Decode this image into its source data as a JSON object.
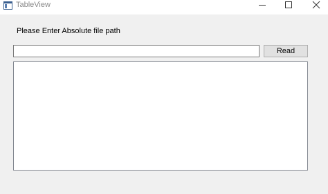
{
  "window": {
    "title": "TableView",
    "controls": {
      "minimize_icon": "minimize-icon",
      "maximize_icon": "maximize-icon",
      "close_icon": "close-icon"
    }
  },
  "form": {
    "prompt_label": "Please Enter Absolute file path",
    "path_value": "",
    "path_placeholder": "",
    "read_button_label": "Read"
  },
  "table": {
    "columns": [],
    "rows": []
  },
  "colors": {
    "window_background": "#f0f0f0",
    "titlebar_background": "#ffffff",
    "button_background": "#e1e1e1"
  }
}
